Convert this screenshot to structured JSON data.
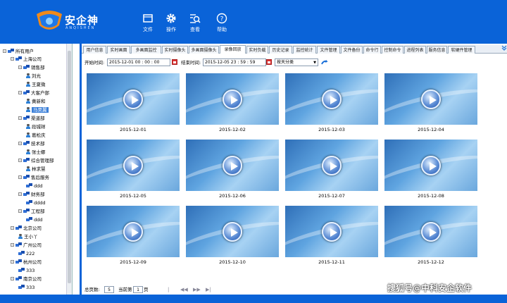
{
  "app": {
    "name": "安企神",
    "subtitle": "ANQISHEN"
  },
  "menu": [
    {
      "label": "文件",
      "icon": "folder-icon"
    },
    {
      "label": "操作",
      "icon": "gear-icon"
    },
    {
      "label": "查看",
      "icon": "view-search-icon"
    },
    {
      "label": "帮助",
      "icon": "help-icon"
    }
  ],
  "tree": {
    "root": "所有用户",
    "nodes": [
      "上海公司",
      "销售部",
      "刘光",
      "王夏微",
      "大客户部",
      "黄新和",
      "马昊翼",
      "渠道部",
      "段城祥",
      "葛松庆",
      "技术部",
      "张士娜",
      "综合管理部",
      "林求慧",
      "售后服务",
      "ddd",
      "财务部",
      "dddd",
      "工程部",
      "ddd",
      "北京公司",
      "王小丫",
      "广州公司",
      "222",
      "杭州公司",
      "333",
      "南京公司",
      "333"
    ]
  },
  "tabs": [
    "用户信息",
    "实时画面",
    "多画面监控",
    "实时摄像头",
    "多画面摄像头",
    "录像回放",
    "实时负载",
    "历史记录",
    "监控统计",
    "文件管理",
    "文件备份",
    "命令行",
    "控制命令",
    "进程列表",
    "服务信息",
    "软硬件管理"
  ],
  "active_tab": "录像回放",
  "filter": {
    "start_label": "开始时间:",
    "start_date": "2015-12-01",
    "start_h": "00",
    "start_m": "00",
    "start_s": "00",
    "end_label": "结束时间:",
    "end_date": "2015-12-05",
    "end_h": "23",
    "end_m": "59",
    "end_s": "59",
    "group_select": "按天分类"
  },
  "videos": [
    "2015-12-01",
    "2015-12-02",
    "2015-12-03",
    "2015-12-04",
    "2015-12-05",
    "2015-12-06",
    "2015-12-07",
    "2015-12-08",
    "2015-12-09",
    "2015-12-10",
    "2015-12-11",
    "2015-12-12"
  ],
  "pager": {
    "total_label": "总页数:",
    "total": "5",
    "current_label": "当前第",
    "current": "1",
    "page_suffix": "页"
  },
  "watermark": "搜狐号@中科安企软件",
  "colors": {
    "header": "#0a63d8",
    "selected": "#3b7fd8"
  }
}
